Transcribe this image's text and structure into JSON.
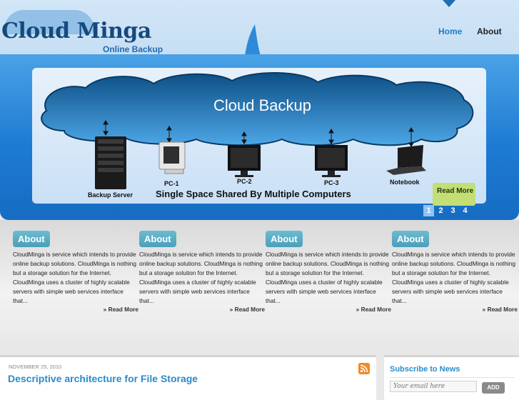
{
  "brand": {
    "title": "Cloud Minga",
    "subtitle": "Online Backup"
  },
  "nav": [
    {
      "label": "Home",
      "active": true
    },
    {
      "label": "About",
      "active": false
    }
  ],
  "slide": {
    "title": "Cloud Backup",
    "devices": [
      "Backup Server",
      "PC-1",
      "PC-2",
      "PC-3",
      "Notebook"
    ],
    "caption": "Single Space Shared By Multiple Computers",
    "read_more": "Read More",
    "pages": [
      "1",
      "2",
      "3",
      "4"
    ],
    "active_page": "1"
  },
  "columns": [
    {
      "heading": "About",
      "body": "CloudMinga is service which intends to provide online backup solutions. CloudMinga is nothing but a storage solution for the Internet. CloudMinga uses a cluster of highly scalable servers with simple web services interface that...",
      "more": "» Read More"
    },
    {
      "heading": "About",
      "body": "CloudMinga is service which intends to provide online backup solutions. CloudMinga is nothing but a storage solution for the Internet. CloudMinga uses a cluster of highly scalable servers with simple web services interface that...",
      "more": "» Read More"
    },
    {
      "heading": "About",
      "body": "CloudMinga is service which intends to provide online backup solutions. CloudMinga is nothing but a storage solution for the Internet. CloudMinga uses a cluster of highly scalable servers with simple web services interface that...",
      "more": "» Read More"
    },
    {
      "heading": "About",
      "body": "CloudMinga is service which intends to provide online backup solutions. CloudMinga is nothing but a storage solution for the Internet. CloudMinga uses a cluster of highly scalable servers with simple web services interface that...",
      "more": "» Read More"
    }
  ],
  "post": {
    "date": "NOVEMBER 25, 2010",
    "title": "Descriptive architecture for File Storage",
    "icon": "rss-icon"
  },
  "subscribe": {
    "title": "Subscribe to News",
    "placeholder": "Your email here",
    "button": "ADD"
  },
  "colors": {
    "accent": "#1f7cc6",
    "band": "#1e7bd3",
    "column_head": "#5aaec6",
    "read_more_box": "#c3de74",
    "post_title": "#2a8cc9"
  }
}
